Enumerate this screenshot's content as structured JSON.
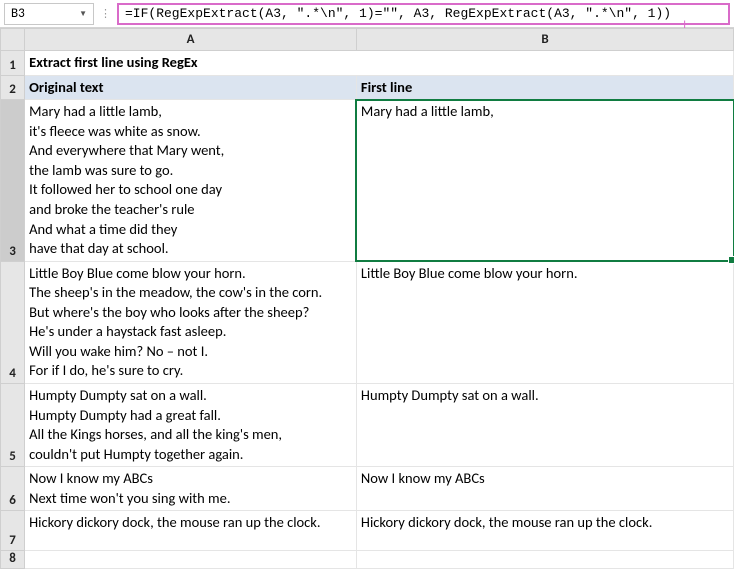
{
  "name_box": "B3",
  "fx_label": "⋮",
  "formula": "=IF(RegExpExtract(A3, \".*\\n\", 1)=\"\", A3, RegExpExtract(A3, \".*\\n\", 1))",
  "columns": [
    "A",
    "B"
  ],
  "title": "Extract first line using RegEx",
  "headers": {
    "A": "Original text",
    "B": "First line"
  },
  "rows": [
    {
      "n": "3",
      "A": "Mary had a little lamb,\nit's fleece was white as snow.\nAnd everywhere that Mary went,\nthe lamb was sure to go.\nIt followed her to school one day\nand broke the teacher's rule\nAnd what a time did they\nhave that day at school.",
      "B": "Mary had a little lamb,"
    },
    {
      "n": "4",
      "A": "Little Boy Blue come blow your horn.\nThe sheep's in the meadow, the cow's in the corn.\nBut where's the boy who looks after the sheep?\nHe's under a haystack fast asleep.\nWill you wake him? No – not I.\nFor if I do, he's sure to cry.",
      "B": "Little Boy Blue come blow your horn."
    },
    {
      "n": "5",
      "A": "Humpty Dumpty sat on a wall.\nHumpty Dumpty had a great fall.\nAll the Kings horses, and all the king's men,\ncouldn't put Humpty together again.",
      "B": "Humpty Dumpty sat on a wall."
    },
    {
      "n": "6",
      "A": "Now I know my ABCs\nNext time won't you sing with me.",
      "B": "Now I know my ABCs"
    },
    {
      "n": "7",
      "A": "Hickory dickory dock, the mouse ran up the clock.",
      "B": "Hickory dickory dock, the mouse ran up the clock."
    },
    {
      "n": "8",
      "A": "",
      "B": ""
    }
  ]
}
